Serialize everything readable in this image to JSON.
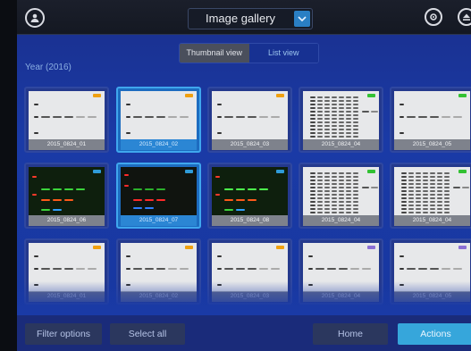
{
  "topbar": {
    "title": "Image gallery"
  },
  "view_toggle": {
    "thumbnail_label": "Thumbnail view",
    "list_label": "List view"
  },
  "year_label": "Year (2016)",
  "thumbnails": [
    {
      "name": "2015_0824_01",
      "tag": "#f0a010",
      "style": "light",
      "selected": false
    },
    {
      "name": "2015_0824_02",
      "tag": "#f0a010",
      "style": "light",
      "selected": true
    },
    {
      "name": "2015_0824_03",
      "tag": "#f0a010",
      "style": "light",
      "selected": false
    },
    {
      "name": "2015_0824_04",
      "tag": "#33c133",
      "style": "lanes",
      "selected": false
    },
    {
      "name": "2015_0824_05",
      "tag": "#33c133",
      "style": "light",
      "selected": false
    },
    {
      "name": "2015_0824_06",
      "tag": "#2f9bd8",
      "style": "fluor_green",
      "selected": false
    },
    {
      "name": "2015_0824_07",
      "tag": "#2f9bd8",
      "style": "fluor_rgb",
      "selected": true
    },
    {
      "name": "2015_0824_08",
      "tag": "#2f9bd8",
      "style": "fluor_green_bright",
      "selected": false
    },
    {
      "name": "2015_0824_04",
      "tag": "#33c133",
      "style": "lanes",
      "selected": false
    },
    {
      "name": "2015_0824_04",
      "tag": "#33c133",
      "style": "lanes",
      "selected": false
    },
    {
      "name": "2015_0824_01",
      "tag": "#f0a010",
      "style": "light",
      "selected": false
    },
    {
      "name": "2015_0824_02",
      "tag": "#f0a010",
      "style": "light",
      "selected": false
    },
    {
      "name": "2015_0824_03",
      "tag": "#f0a010",
      "style": "light",
      "selected": false
    },
    {
      "name": "2015_0824_04",
      "tag": "#8b6fd4",
      "style": "light",
      "selected": false
    },
    {
      "name": "2015_0824_05",
      "tag": "#8b6fd4",
      "style": "light",
      "selected": false
    }
  ],
  "bottombar": {
    "filter_label": "Filter options",
    "select_all_label": "Select all",
    "home_label": "Home",
    "actions_label": "Actions"
  },
  "icons": {
    "left": "user-icon",
    "right_1": "gear-icon",
    "right_2": "eject-icon",
    "dropdown": "chevron-down-icon"
  }
}
